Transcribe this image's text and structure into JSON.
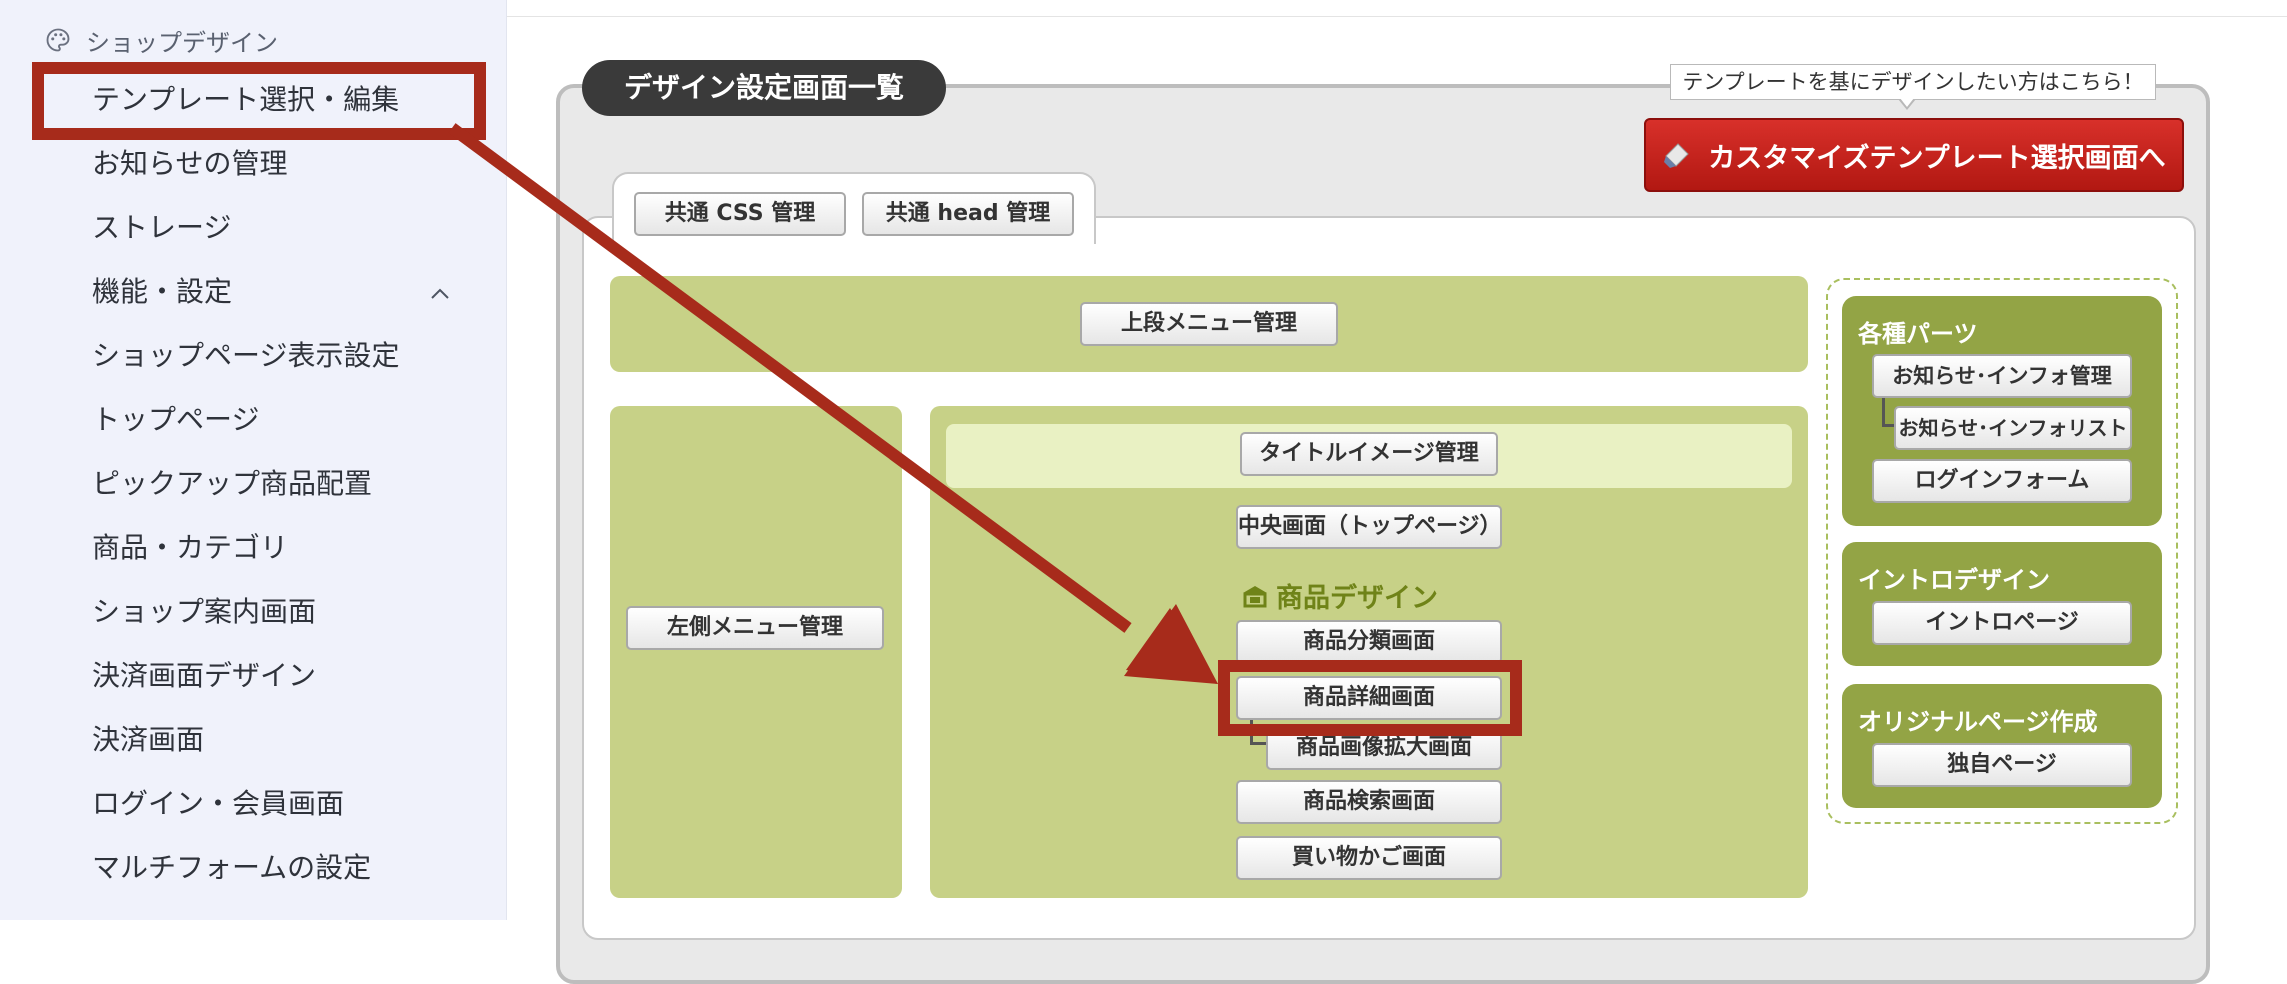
{
  "sidebar": {
    "header": "ショップデザイン",
    "items": [
      {
        "label": "テンプレート選択・編集"
      },
      {
        "label": "お知らせの管理"
      },
      {
        "label": "ストレージ"
      },
      {
        "label": "機能・設定"
      },
      {
        "label": "ショップページ表示設定"
      },
      {
        "label": "トップページ"
      },
      {
        "label": "ピックアップ商品配置"
      },
      {
        "label": "商品・カテゴリ"
      },
      {
        "label": "ショップ案内画面"
      },
      {
        "label": "決済画面デザイン"
      },
      {
        "label": "決済画面"
      },
      {
        "label": "ログイン・会員画面"
      },
      {
        "label": "マルチフォームの設定"
      }
    ]
  },
  "panel": {
    "title": "デザイン設定画面一覧",
    "template_note": "テンプレートを基にデザインしたい方はこちら！",
    "custom_button": "カスタマイズテンプレート選択画面へ",
    "tabs": {
      "css": "共通 CSS 管理",
      "head": "共通 head 管理"
    },
    "top_menu": "上段メニュー管理",
    "left_menu": "左側メニュー管理",
    "center": {
      "title_image": "タイトルイメージ管理",
      "top_page": "中央画面（トップページ）",
      "product_design_label": "商品デザイン",
      "category": "商品分類画面",
      "detail": "商品詳細画面",
      "image_zoom": "商品画像拡大画面",
      "search": "商品検索画面",
      "cart": "買い物かご画面"
    },
    "parts": {
      "title": "各種パーツ",
      "info_manage": "お知らせ･インフォ管理",
      "info_list": "お知らせ･インフォリスト",
      "login_form": "ログインフォーム"
    },
    "intro": {
      "title": "イントロデザイン",
      "page": "イントロページ"
    },
    "original": {
      "title": "オリジナルページ作成",
      "page": "独自ページ"
    }
  },
  "colors": {
    "annotation_red": "#a72b1b",
    "green": "#c7d187",
    "dark_green": "#93a445",
    "button_red": "#c4221c"
  }
}
